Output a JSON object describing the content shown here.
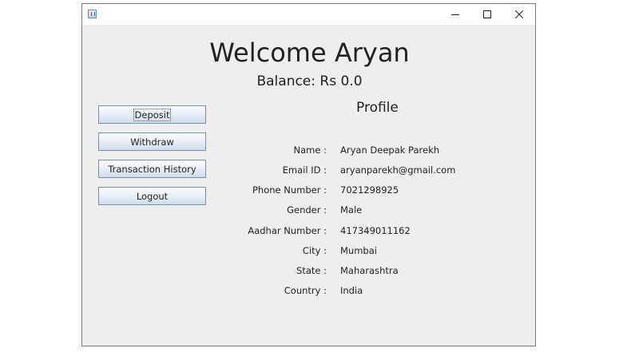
{
  "window": {
    "controls": {
      "minimize": "─",
      "maximize": "☐",
      "close": "✕"
    }
  },
  "header": {
    "welcome": "Welcome Aryan",
    "balance": "Balance: Rs 0.0"
  },
  "profile": {
    "title": "Profile",
    "fields": [
      {
        "label": "Name :",
        "value": "Aryan Deepak Parekh"
      },
      {
        "label": "Email ID :",
        "value": "aryanparekh@gmail.com"
      },
      {
        "label": "Phone Number :",
        "value": "7021298925"
      },
      {
        "label": "Gender :",
        "value": "Male"
      },
      {
        "label": "Aadhar Number :",
        "value": "417349011162"
      },
      {
        "label": "City :",
        "value": "Mumbai"
      },
      {
        "label": "State :",
        "value": "Maharashtra"
      },
      {
        "label": "Country :",
        "value": "India"
      }
    ]
  },
  "actions": {
    "deposit": "Deposit",
    "withdraw": "Withdraw",
    "transaction_history": "Transaction History",
    "logout": "Logout"
  }
}
